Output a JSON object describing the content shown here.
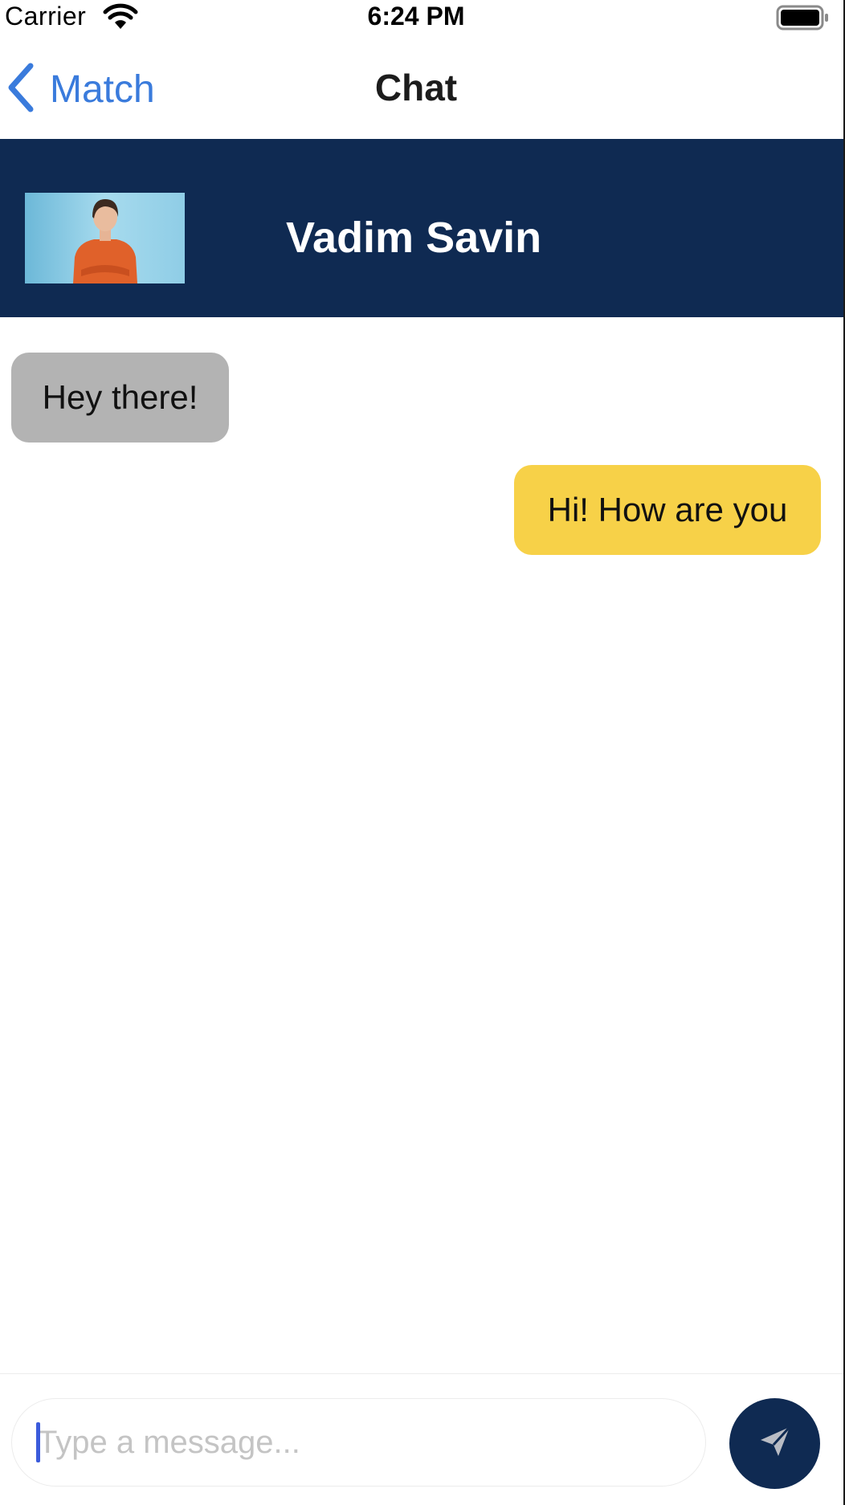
{
  "status_bar": {
    "carrier": "Carrier",
    "time": "6:24 PM",
    "icons": [
      "wifi-icon",
      "battery-icon"
    ]
  },
  "nav": {
    "back_label": "Match",
    "title": "Chat",
    "accent_color": "#3a7bdc"
  },
  "header": {
    "contact_name": "Vadim Savin",
    "background_color": "#0f2a52"
  },
  "messages": [
    {
      "text": "Hey there!",
      "direction": "incoming",
      "color": "#b3b3b3"
    },
    {
      "text": "Hi! How are you",
      "direction": "outgoing",
      "color": "#f7d148"
    }
  ],
  "composer": {
    "placeholder": "Type a message...",
    "value": "",
    "send_icon": "send-icon"
  }
}
